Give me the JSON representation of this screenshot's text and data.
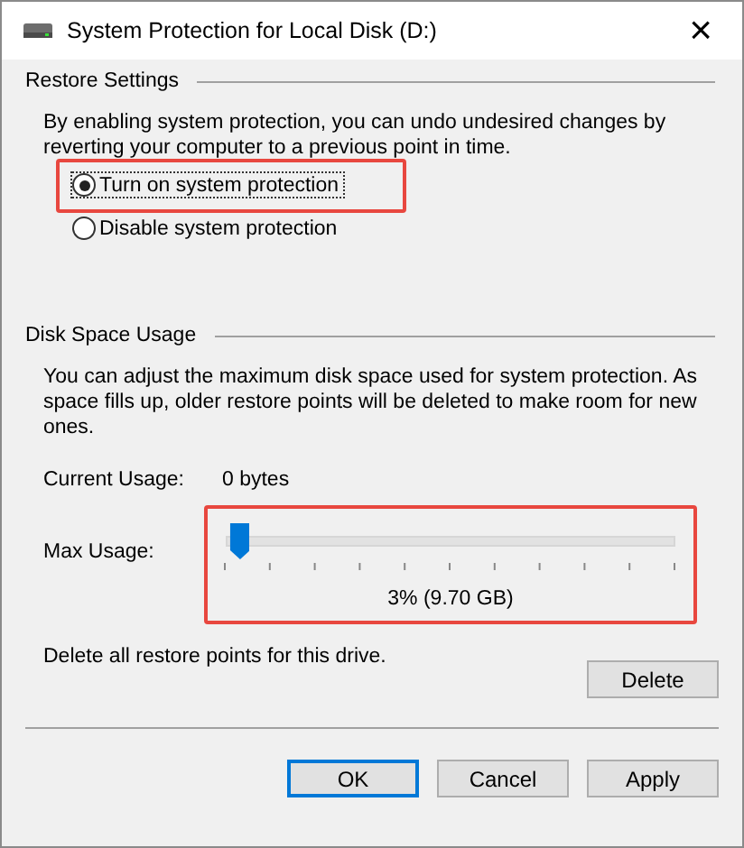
{
  "window": {
    "title": "System Protection for Local Disk (D:)",
    "close": "×"
  },
  "restore_settings": {
    "heading": "Restore Settings",
    "description": "By enabling system protection, you can undo undesired changes by reverting your computer to a previous point in time.",
    "options": [
      {
        "label": "Turn on system protection",
        "selected": true
      },
      {
        "label": "Disable system protection",
        "selected": false
      }
    ]
  },
  "disk_space_usage": {
    "heading": "Disk Space Usage",
    "description": "You can adjust the maximum disk space used for system protection. As space fills up, older restore points will be deleted to make room for new ones.",
    "current_usage_label": "Current Usage:",
    "current_usage_value": "0 bytes",
    "max_usage_label": "Max Usage:",
    "max_usage": {
      "level": 0.03,
      "reading": "3% (9.70 GB)"
    },
    "delete_text": "Delete all restore points for this drive.",
    "delete_button": "Delete"
  },
  "buttons": [
    {
      "label": "OK",
      "selected": true
    },
    {
      "label": "Cancel",
      "selected": false
    },
    {
      "label": "Apply",
      "selected": false
    }
  ]
}
